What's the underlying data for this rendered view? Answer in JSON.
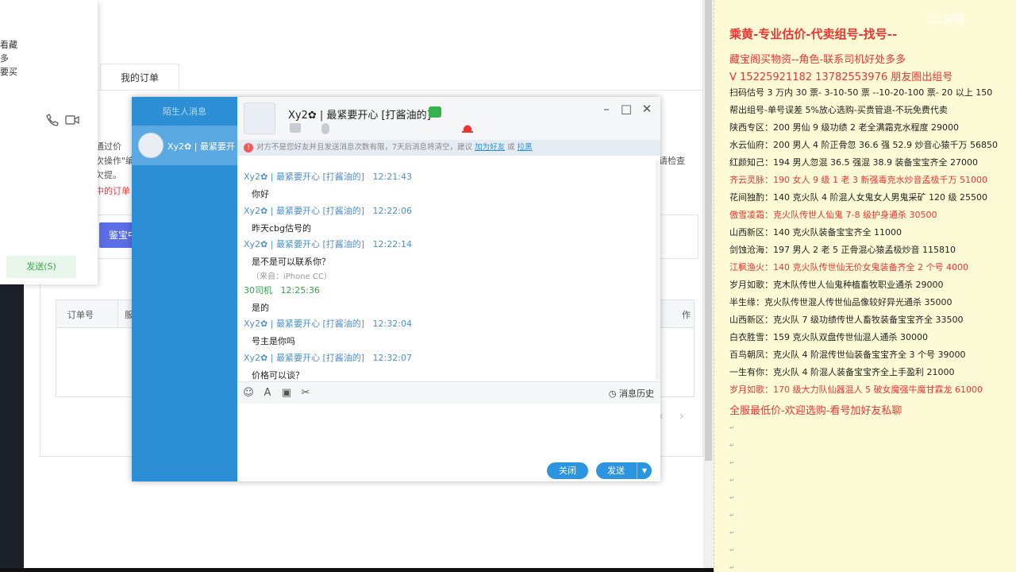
{
  "background_page": {
    "tab_label": "我的订单",
    "notice_lines": [
      "通过价",
      "次操作\"编",
      "欠提。"
    ],
    "notice_red": "中的订单",
    "right_hint": "请检查",
    "appraise_button": "鉴宝中",
    "table_headers": [
      "订单号",
      "服",
      "作"
    ],
    "pager": [
      "‹",
      "›"
    ]
  },
  "contact_panel": {
    "lines": [
      "看藏",
      "多",
      "要买"
    ],
    "send_button": "发送(S)"
  },
  "chat_window": {
    "sidebar_title": "陌生人消息",
    "contact_name": "Xy2✿ | 最紧要开...",
    "header_title": "Xy2✿ | 最紧要开心 [打酱油的]",
    "warning_text": "对方不是您好友并且发送消息次数有限，7天后消息将清空，建议",
    "warning_link_add": "加为好友",
    "warning_or": "或",
    "warning_link_block": "拉黑",
    "messages": [
      {
        "sender": "Xy2✿ | 最紧要开心 [打酱油的]",
        "time": "12:21:43",
        "text": "你好",
        "source": ""
      },
      {
        "sender": "Xy2✿ | 最紧要开心 [打酱油的]",
        "time": "12:22:06",
        "text": "昨天cbg估号的",
        "source": ""
      },
      {
        "sender": "Xy2✿ | 最紧要开心 [打酱油的]",
        "time": "12:22:14",
        "text": "是不是可以联系你？",
        "source": "（来自：iPhone CC）"
      },
      {
        "sender": "30司机",
        "time": "12:25:36",
        "text": "是的",
        "source": ""
      },
      {
        "sender": "Xy2✿ | 最紧要开心 [打酱油的]",
        "time": "12:32:04",
        "text": "号主是你吗",
        "source": ""
      },
      {
        "sender": "Xy2✿ | 最紧要开心 [打酱油的]",
        "time": "12:32:07",
        "text": "价格可以谈？",
        "source": ""
      }
    ],
    "history_label": "消息历史",
    "close_button": "关闭",
    "send_button": "发送"
  },
  "watermark": "CC直播",
  "notes": {
    "title": "乘黄-专业估价-代卖组号-找号--",
    "lines": [
      {
        "text": "藏宝阁买物资--角色-联系司机好处多多",
        "style": "red big"
      },
      {
        "text": "V 15225921182   13782553976 朋友圈出组号",
        "style": "red big"
      },
      {
        "text": "扫码估号 3 万内 30 票- 3-10-50 票  --10-20-100 票- 20 以上 150",
        "style": ""
      },
      {
        "text": "帮出组号-单号误差 5%放心选购-买贵管退-不玩免费代卖",
        "style": ""
      },
      {
        "text": "陕西专区：200 男仙 9 级功绩 2 老全满霜克水程度 29000",
        "style": ""
      },
      {
        "text": "水云仙府：200 男人 4 阶正骨忽 36.6 强 52.9 炒音心猿千万 56850",
        "style": ""
      },
      {
        "text": "红颜知己：194 男人忽混 36.5 强混 38.9 装备宝宝齐全 27000",
        "style": ""
      },
      {
        "text": "齐云灵脉：190 女人 9 级 1 老 3 新强毒克水炒音孟极千万 51000",
        "style": "red"
      },
      {
        "text": "花间独酌：140 克火队 4 阶混人女鬼女人男鬼采矿 120 级 25500",
        "style": ""
      },
      {
        "text": "傲雪凌霜：克火队传世人仙鬼 7-8 级护身通杀 30500",
        "style": "red"
      },
      {
        "text": "山西新区：140 克火队装备宝宝齐全 11000",
        "style": ""
      },
      {
        "text": "剑蚀沧海：197 男人 2 老 5 正骨混心猿孟极炒音 115810",
        "style": ""
      },
      {
        "text": "江枫渔火：140 克火队传世仙无价女鬼装备齐全 2 个号 4000",
        "style": "red"
      },
      {
        "text": "岁月如歌：克木队传世人仙鬼种植畜牧职业通杀 29000",
        "style": ""
      },
      {
        "text": "半生缘：克火队传世混人传世仙品像较好异光通杀 35000",
        "style": ""
      },
      {
        "text": "山西新区：克火队 7 级功绩传世人畜牧装备宝宝齐全 33500",
        "style": ""
      },
      {
        "text": "白衣胜雪：159 克火队双盘传世仙混人通杀 30000",
        "style": ""
      },
      {
        "text": "百鸟朝凤：克火队 4 阶混传世仙装备宝宝齐全 3 个号 39000",
        "style": ""
      },
      {
        "text": "一生有你：克火队 4 阶混人装备宝宝齐全上手盈利 21000",
        "style": ""
      },
      {
        "text": "岁月如歌：170 级大力队仙器混人 5 破女魔强牛魔甘霖龙 61000",
        "style": "red"
      },
      {
        "text": "全服最低价-欢迎选购-看号加好友私聊",
        "style": "red big"
      }
    ],
    "paragraph_mark": "↵"
  }
}
